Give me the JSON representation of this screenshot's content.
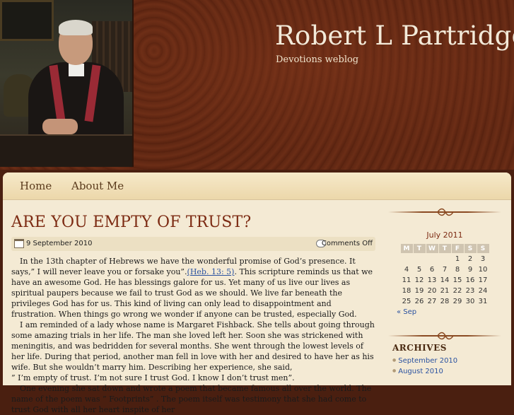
{
  "header": {
    "site_title": "Robert L Partridge",
    "site_description": "Devotions weblog"
  },
  "nav": {
    "items": [
      {
        "label": "Home"
      },
      {
        "label": "About Me"
      }
    ]
  },
  "post": {
    "title": "ARE YOU EMPTY OF TRUST?",
    "date": "9 September 2010",
    "comments": "Comments Off",
    "p1_a": "In the 13th chapter of Hebrews we have the wonderful promise of God’s presence. It says,” I will never leave you or forsake you”.",
    "p1_ref": "(Heb. 13: 5)",
    "p1_b": ". This scripture reminds us that we have an awesome God. He has blessings galore for us. Yet many of us live our lives as spiritual paupers because we fail to trust God as we should. We live far beneath the privileges God has for us. This kind of living can only lead to disappointment and frustration. When things go wrong we wonder if anyone can be trusted, especially God.",
    "p2": "I am reminded of a lady whose name is Margaret Fishback. She tells about going through some amazing trials in her life. The man she loved left her. Soon she was strickened with meningitis, and was bedridden for several months. She went through the lowest levels of her life. During that period, another man fell in love with her and desired to have her as his wife. But she wouldn’t marry him. Describing her experience, she said,",
    "p3": "” I’m empty of trust. I’m not sure I trust God. I know I don’t trust men”.",
    "p4": "One evening she sat down and wrote a poem that became famous all over the world. The name of the poem was ” Footprints” . The poem itself was testimony that she had come to trust God with all her heart inspite of her"
  },
  "calendar": {
    "caption": "July 2011",
    "weekdays": [
      "M",
      "T",
      "W",
      "T",
      "F",
      "S",
      "S"
    ],
    "weeks": [
      [
        "",
        "",
        "",
        "",
        "1",
        "2",
        "3"
      ],
      [
        "4",
        "5",
        "6",
        "7",
        "8",
        "9",
        "10"
      ],
      [
        "11",
        "12",
        "13",
        "14",
        "15",
        "16",
        "17"
      ],
      [
        "18",
        "19",
        "20",
        "21",
        "22",
        "23",
        "24"
      ],
      [
        "25",
        "26",
        "27",
        "28",
        "29",
        "30",
        "31"
      ]
    ],
    "prev_link": "« Sep"
  },
  "archives": {
    "title": "ARCHIVES",
    "items": [
      "September 2010",
      "August 2010"
    ]
  },
  "colors": {
    "header_bg": "#5a2412",
    "page_bg": "#f4ead4",
    "title_red": "#7c2a12",
    "link_blue": "#2a52a0"
  }
}
